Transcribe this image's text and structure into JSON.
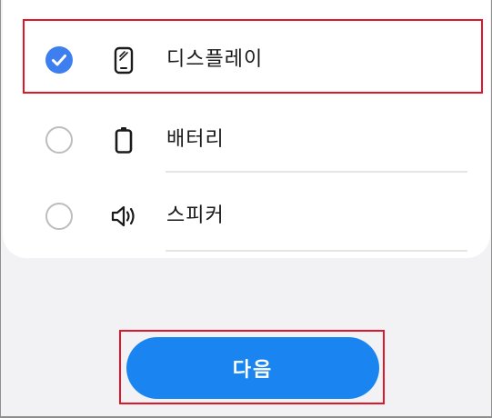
{
  "options": [
    {
      "label": "디스플레이",
      "icon": "phone-display-icon",
      "checked": true
    },
    {
      "label": "배터리",
      "icon": "battery-icon",
      "checked": false
    },
    {
      "label": "스피커",
      "icon": "speaker-icon",
      "checked": false
    }
  ],
  "next_button": {
    "label": "다음"
  },
  "colors": {
    "accent": "#3e7ff0",
    "button": "#1a84f0",
    "highlight": "#e0162b",
    "background": "#f2f2f4"
  }
}
